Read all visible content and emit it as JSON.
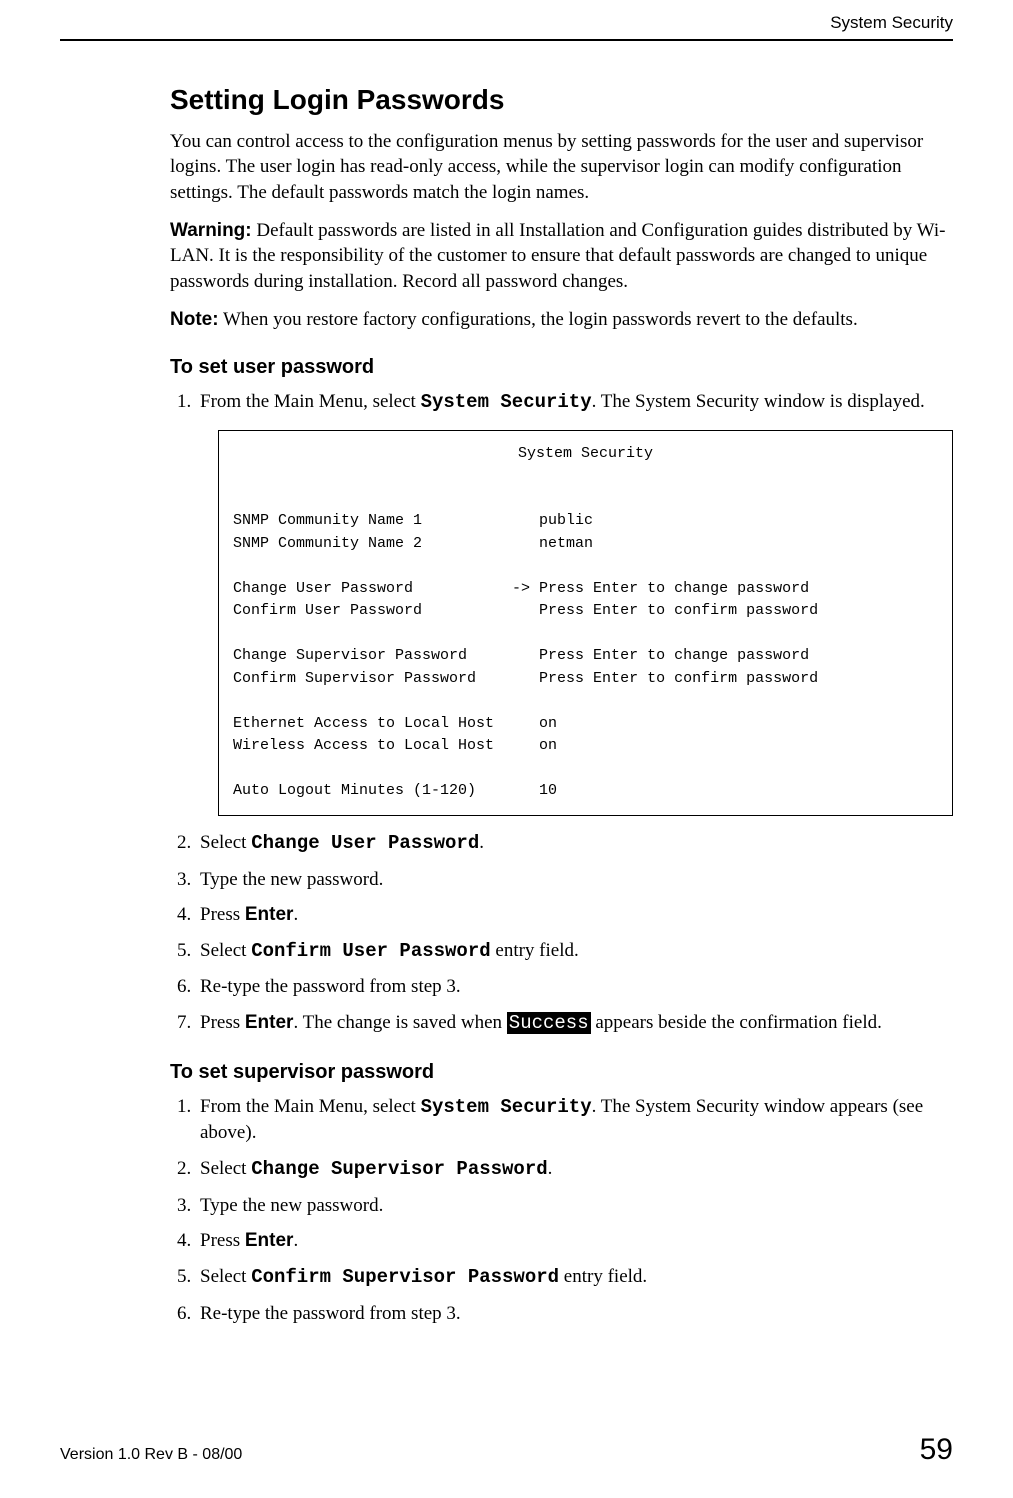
{
  "header": {
    "running_head": "System Security"
  },
  "section": {
    "title": "Setting Login Passwords",
    "intro": "You can control access to the configuration menus by setting passwords for the user and supervisor logins. The user login has read-only access, while the supervisor login can modify configuration settings. The default passwords match the login names.",
    "warning_label": "Warning:",
    "warning_body": " Default passwords are listed in all Installation and Configuration guides distributed by Wi-LAN. It is the responsibility of the customer to ensure that default passwords are changed to unique passwords during installation. Record all password changes.",
    "note_label": "Note:",
    "note_body": " When you restore factory configurations, the login passwords revert to the defaults."
  },
  "user_pw": {
    "heading": "To set user password",
    "step1_a": "From the Main Menu, select ",
    "step1_cmd": "System Security",
    "step1_b": ". The System Security window is displayed.",
    "step2_a": "Select ",
    "step2_cmd": "Change User Password",
    "step2_b": ".",
    "step3": "Type the new password.",
    "step4_a": "Press ",
    "step4_key": "Enter",
    "step4_b": ".",
    "step5_a": "Select ",
    "step5_cmd": "Confirm User Password",
    "step5_b": " entry field.",
    "step6": "Re-type the password from step 3.",
    "step7_a": "Press ",
    "step7_key": "Enter",
    "step7_b": ". The change is saved when ",
    "step7_hl": "Success",
    "step7_c": " appears beside the confirmation field."
  },
  "terminal": {
    "title": "System Security",
    "l1": "SNMP Community Name 1             public",
    "l2": "SNMP Community Name 2             netman",
    "l3": "Change User Password           -> Press Enter to change password",
    "l4": "Confirm User Password             Press Enter to confirm password",
    "l5": "Change Supervisor Password        Press Enter to change password",
    "l6": "Confirm Supervisor Password       Press Enter to confirm password",
    "l7": "Ethernet Access to Local Host     on",
    "l8": "Wireless Access to Local Host     on",
    "l9": "Auto Logout Minutes (1-120)       10"
  },
  "sup_pw": {
    "heading": "To set supervisor password",
    "step1_a": "From the Main Menu, select ",
    "step1_cmd": "System Security",
    "step1_b": ". The System Security window appears (see above).",
    "step2_a": "Select ",
    "step2_cmd": "Change Supervisor Password",
    "step2_b": ".",
    "step3": "Type the new password.",
    "step4_a": "Press ",
    "step4_key": "Enter",
    "step4_b": ".",
    "step5_a": "Select ",
    "step5_cmd": "Confirm Supervisor Password",
    "step5_b": " entry field.",
    "step6": "Re-type the password from step 3."
  },
  "footer": {
    "version": "Version 1.0 Rev B - 08/00",
    "page": "59"
  }
}
